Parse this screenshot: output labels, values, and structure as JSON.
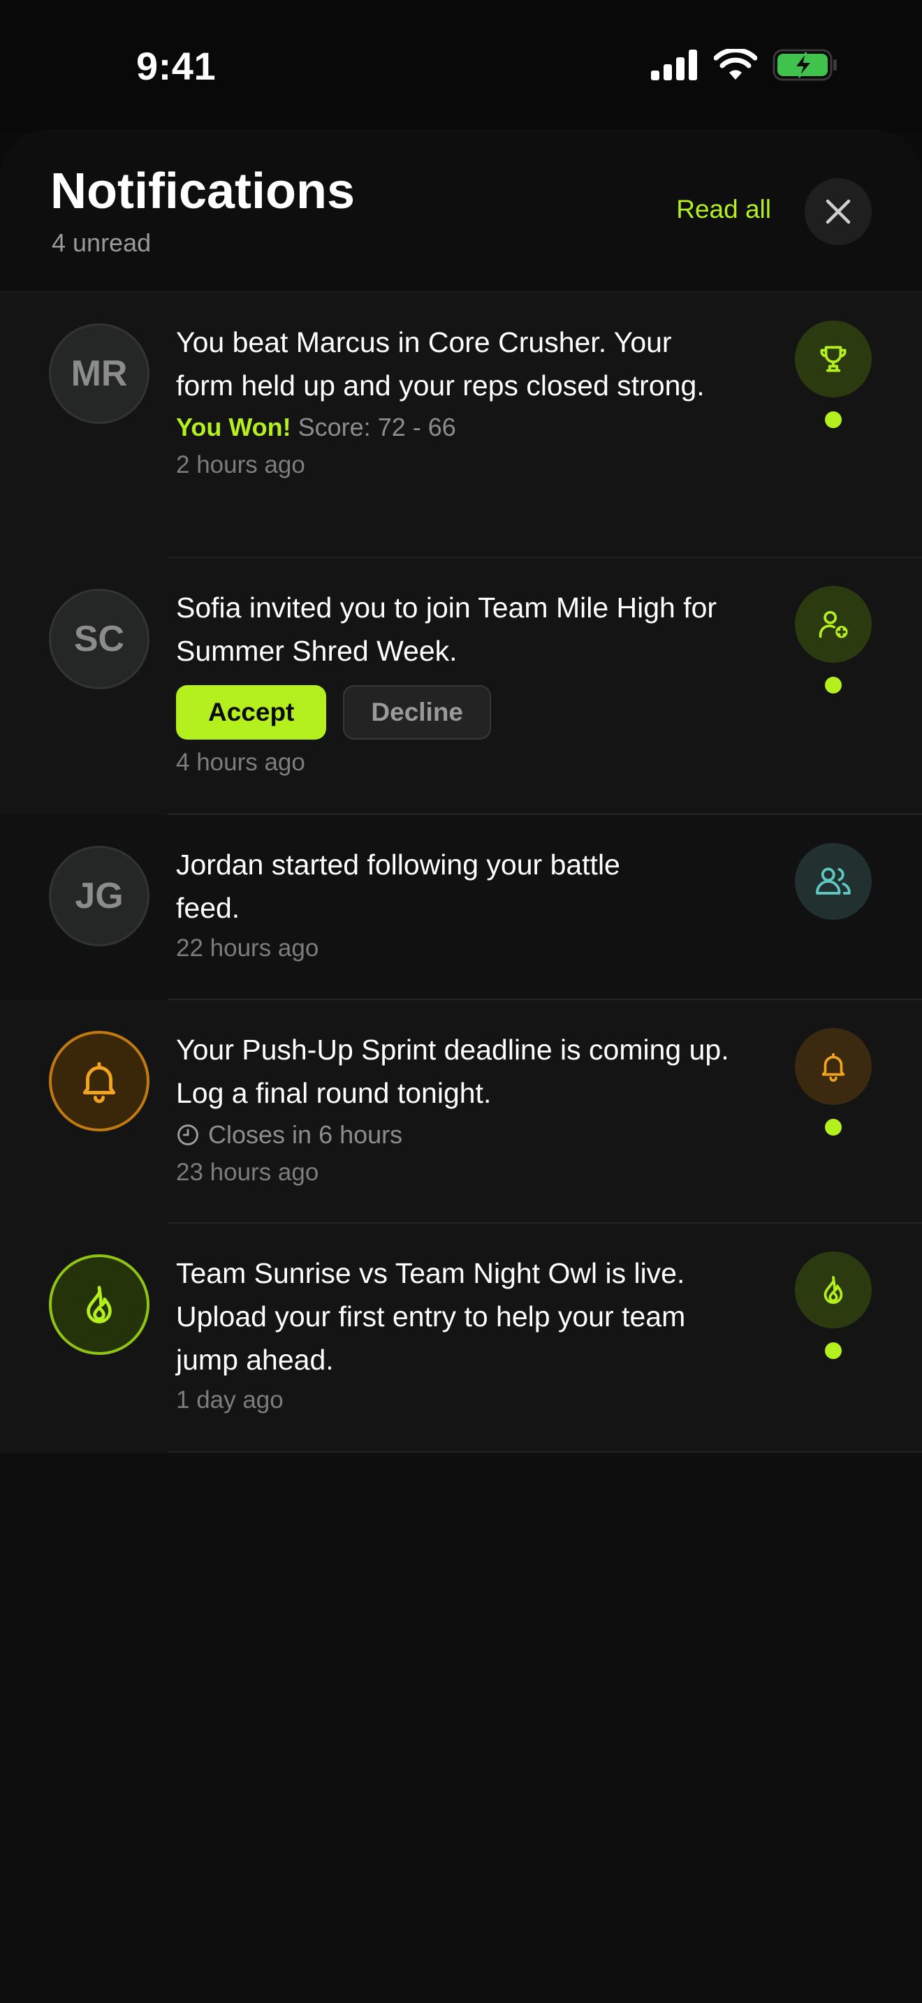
{
  "status_bar": {
    "time": "9:41"
  },
  "header": {
    "title": "Notifications",
    "unread": "4 unread",
    "read_all": "Read all"
  },
  "notifications": [
    {
      "initials": "MR",
      "message": "You beat Marcus in Core Crusher. Your form held up and your reps closed strong.",
      "result": "You Won!",
      "score": "Score: 72 - 66",
      "time": "2 hours ago",
      "icon": "trophy-icon",
      "unread": true
    },
    {
      "initials": "SC",
      "message": "Sofia invited you to join Team Mile High for Summer Shred Week.",
      "accept": "Accept",
      "decline": "Decline",
      "time": "4 hours ago",
      "icon": "user-plus-icon",
      "unread": true
    },
    {
      "initials": "JG",
      "message": "Jordan started following your battle feed.",
      "time": "22 hours ago",
      "icon": "users-icon",
      "unread": false
    },
    {
      "message": "Your Push-Up Sprint deadline is coming up. Log a final round tonight.",
      "closes": "Closes in 6 hours",
      "time": "23 hours ago",
      "icon": "bell-icon",
      "unread": true
    },
    {
      "message": "Team Sunrise vs Team Night Owl is live. Upload your first entry to help your team jump ahead.",
      "time": "1 day ago",
      "icon": "flame-icon",
      "unread": true
    }
  ],
  "colors": {
    "accent": "#b3f01e",
    "warning": "#f2a51c",
    "teal": "#5fc7c2"
  }
}
